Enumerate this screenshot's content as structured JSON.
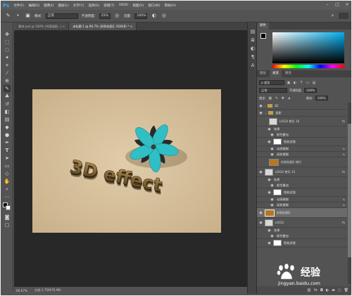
{
  "app": {
    "logo": "Ps",
    "menu": [
      "文件(F)",
      "编辑(E)",
      "图像(I)",
      "图层(L)",
      "文字(Y)",
      "选择(S)",
      "滤镜(T)",
      "3D(D)",
      "视图(V)",
      "窗口(W)",
      "帮助(H)"
    ],
    "window_controls": [
      "–",
      "□",
      "×"
    ]
  },
  "options": {
    "mode_label": "模式:",
    "mode_value": "正常",
    "opacity_label": "不透明度:",
    "opacity_value": "25%",
    "flow_label": "流量:",
    "flow_value": "100%"
  },
  "tabs": [
    {
      "label": "素材.psd @ 100% (中国画图...) ×"
    },
    {
      "label": "未标题-1 @ 66.7% (折射贴图2, RGB/8) * ×"
    }
  ],
  "status": {
    "zoom": "66.67%",
    "doc": "文档:1.75M/76.9M"
  },
  "artwork": {
    "text": "3D effect",
    "colors": {
      "paper": "#d9c3a0",
      "petal": "#2fbfc4",
      "petal_dark": "#2c2c2c",
      "text_gold": "#8a6a3a"
    }
  },
  "panels": {
    "color_tab": "颜色",
    "layer_tabs": [
      "图层",
      "通道",
      "路径"
    ],
    "filter_kind": "ρ 类型",
    "blend_mode": "正常",
    "opacity_label": "不透明度:",
    "opacity_value": "100%",
    "lock_label": "锁定:",
    "fill_label": "填充:",
    "fill_value": "100%"
  },
  "layers": [
    {
      "name": "3D",
      "kind": "folder"
    },
    {
      "name": "投影",
      "kind": "folder"
    },
    {
      "name": "LOGO 拷贝 16",
      "kind": "layer",
      "fx": "fx"
    },
    {
      "name": "效果",
      "kind": "effect"
    },
    {
      "name": "颜色叠加",
      "kind": "effect"
    },
    {
      "name": "智能滤镜",
      "kind": "filter"
    },
    {
      "name": "动感模糊",
      "kind": "filter"
    },
    {
      "name": "高斯模糊",
      "kind": "filter"
    },
    {
      "name": "折射贴图2 拷贝",
      "kind": "layer"
    },
    {
      "name": "LOGO 拷贝 15",
      "kind": "layer",
      "fx": "fx"
    },
    {
      "name": "效果",
      "kind": "effect"
    },
    {
      "name": "颜色叠加",
      "kind": "effect"
    },
    {
      "name": "智能滤镜",
      "kind": "filter"
    },
    {
      "name": "动感模糊",
      "kind": "filter"
    },
    {
      "name": "高斯模糊",
      "kind": "filter"
    },
    {
      "name": "折射贴图2",
      "kind": "layer",
      "selected": true
    },
    {
      "name": "LOGO",
      "kind": "layer",
      "fx": "fx"
    },
    {
      "name": "效果",
      "kind": "effect"
    },
    {
      "name": "颜色叠加",
      "kind": "effect"
    },
    {
      "name": "智能滤镜",
      "kind": "filter"
    }
  ],
  "watermark": {
    "text": "经验",
    "url": "jingyan.baidu.com"
  }
}
